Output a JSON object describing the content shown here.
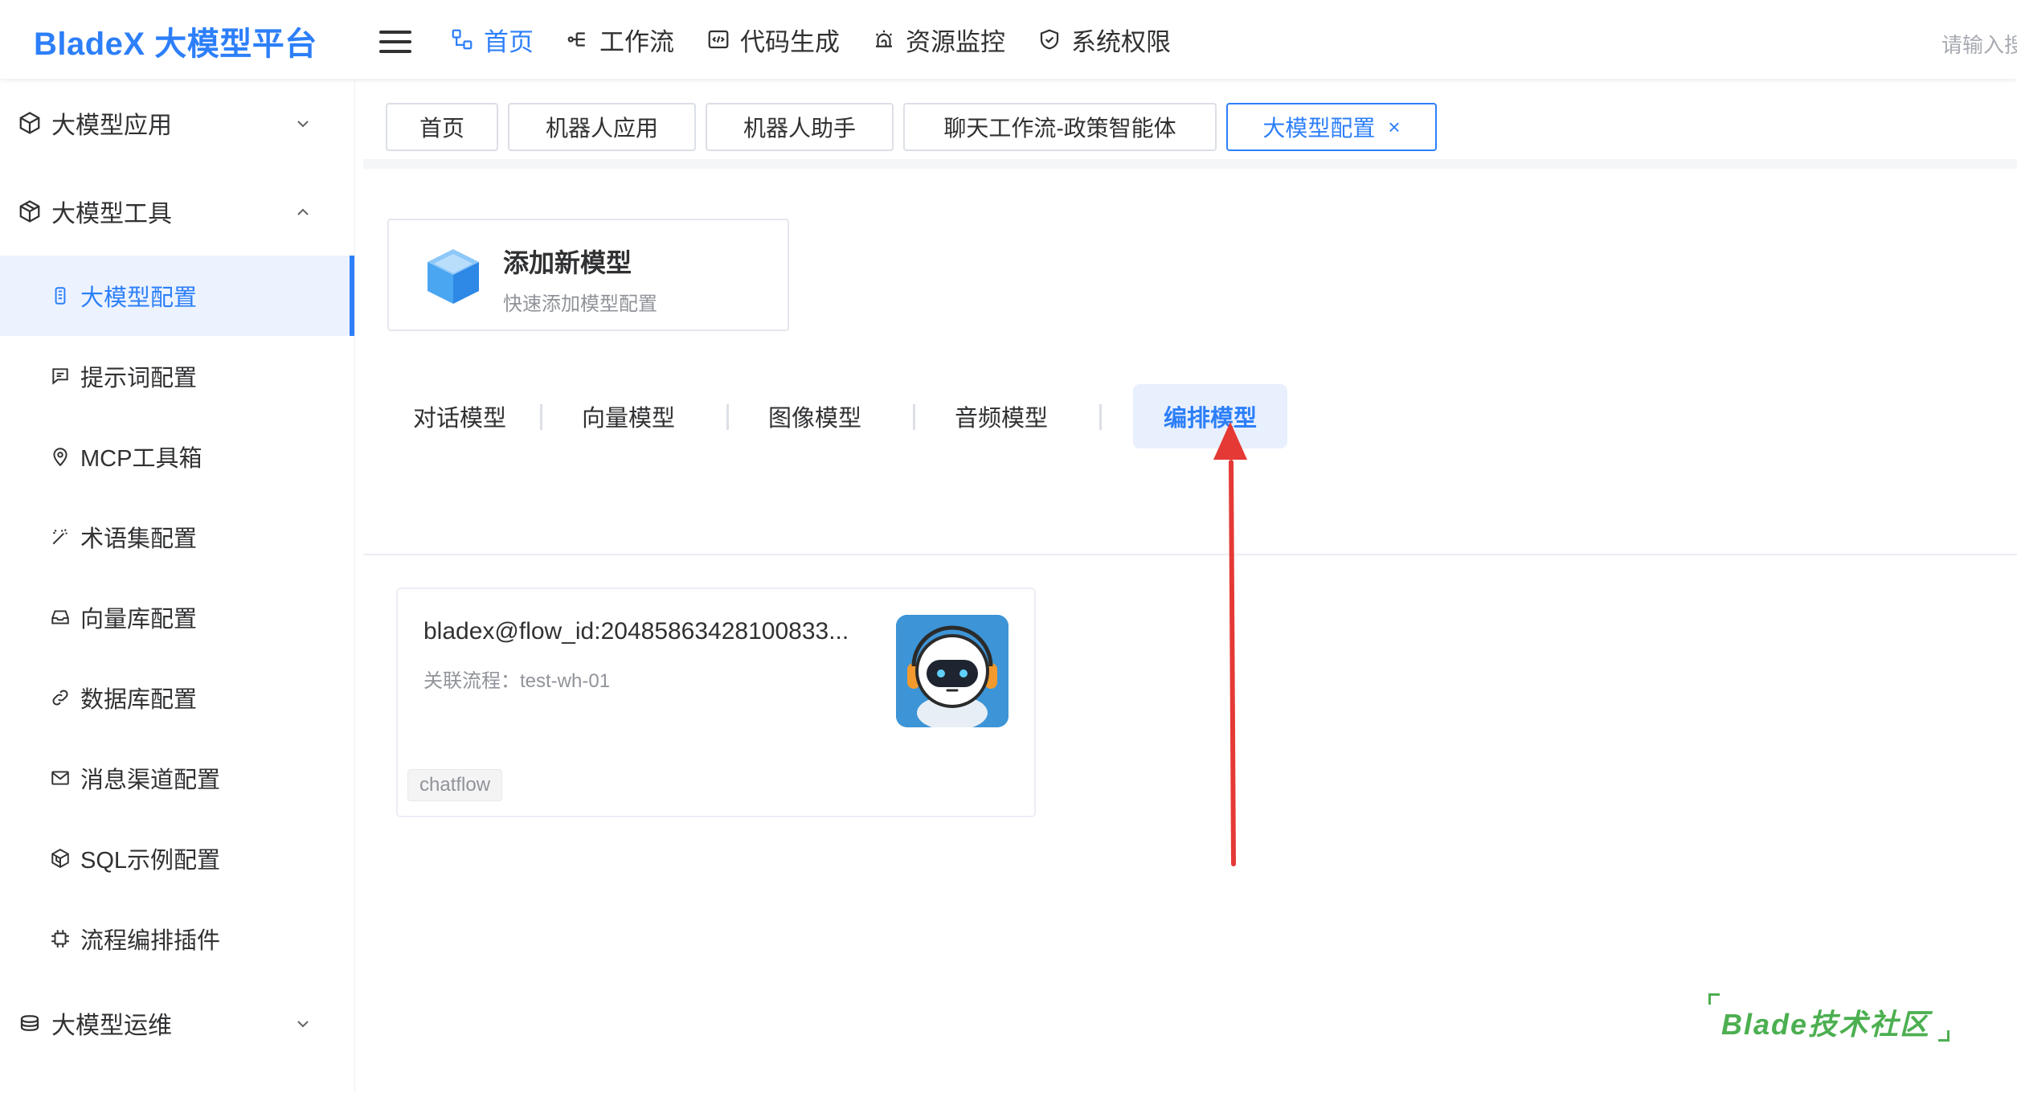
{
  "header": {
    "logo": "BladeX 大模型平台",
    "nav": [
      {
        "label": "首页",
        "icon": "flow-chart-icon",
        "active": true
      },
      {
        "label": "工作流",
        "icon": "workflow-icon"
      },
      {
        "label": "代码生成",
        "icon": "code-icon"
      },
      {
        "label": "资源监控",
        "icon": "alarm-icon"
      },
      {
        "label": "系统权限",
        "icon": "shield-icon"
      }
    ],
    "search_placeholder": "请输入搜"
  },
  "sidebar": {
    "groups": [
      {
        "label": "大模型应用",
        "icon": "cube-outline-icon",
        "expanded": false
      },
      {
        "label": "大模型工具",
        "icon": "box-icon",
        "expanded": true
      },
      {
        "label": "大模型运维",
        "icon": "layers-icon",
        "expanded": false
      }
    ],
    "items": [
      {
        "label": "大模型配置",
        "icon": "chip-icon",
        "active": true
      },
      {
        "label": "提示词配置",
        "icon": "message-icon"
      },
      {
        "label": "MCP工具箱",
        "icon": "location-icon"
      },
      {
        "label": "术语集配置",
        "icon": "magic-wand-icon"
      },
      {
        "label": "向量库配置",
        "icon": "inbox-icon"
      },
      {
        "label": "数据库配置",
        "icon": "link-icon"
      },
      {
        "label": "消息渠道配置",
        "icon": "mail-icon"
      },
      {
        "label": "SQL示例配置",
        "icon": "cube-icon"
      },
      {
        "label": "流程编排插件",
        "icon": "cpu-icon"
      }
    ]
  },
  "tabs": [
    {
      "label": "首页"
    },
    {
      "label": "机器人应用"
    },
    {
      "label": "机器人助手"
    },
    {
      "label": "聊天工作流-政策智能体"
    },
    {
      "label": "大模型配置",
      "active": true,
      "close": "×"
    }
  ],
  "add_card": {
    "title": "添加新模型",
    "subtitle": "快速添加模型配置"
  },
  "model_types": [
    {
      "label": "对话模型"
    },
    {
      "label": "向量模型"
    },
    {
      "label": "图像模型"
    },
    {
      "label": "音频模型"
    },
    {
      "label": "编排模型",
      "active": true
    }
  ],
  "flow_card": {
    "name": "bladex@flow_id:20485863428100833...",
    "related": "关联流程：test-wh-01",
    "tag": "chatflow"
  },
  "watermark": "Blade技术社区",
  "colors": {
    "primary": "#2d7ff9",
    "arrow": "#e53935",
    "watermark": "#4caf50"
  }
}
